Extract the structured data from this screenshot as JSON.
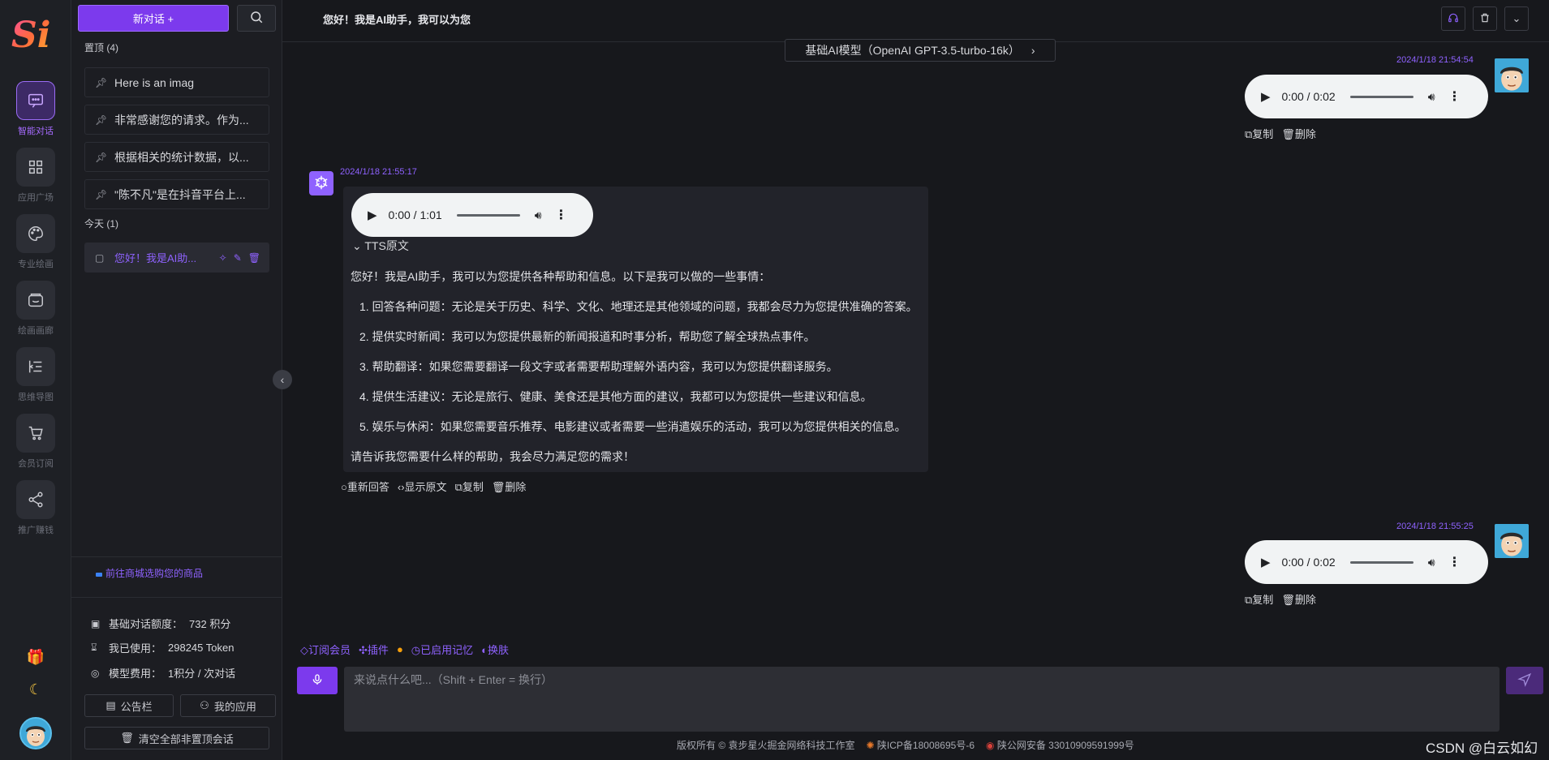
{
  "rail": {
    "logo_text": "Si",
    "items": [
      {
        "label": "智能对话",
        "icon": "chat-icon"
      },
      {
        "label": "应用广场",
        "icon": "grid-icon"
      },
      {
        "label": "专业绘画",
        "icon": "palette-icon"
      },
      {
        "label": "绘画画廊",
        "icon": "gallery-icon"
      },
      {
        "label": "思维导图",
        "icon": "mindmap-icon"
      },
      {
        "label": "会员订阅",
        "icon": "cart-icon"
      },
      {
        "label": "推广赚钱",
        "icon": "share-icon"
      }
    ]
  },
  "sidebar": {
    "new_chat_label": "新对话 +",
    "pinned_title": "置顶  (4)",
    "pinned": [
      "Here is an imag",
      "非常感谢您的请求。作为...",
      "根据相关的统计数据，以...",
      "\"陈不凡\"是在抖音平台上..."
    ],
    "today_title": "今天  (1)",
    "today": [
      "您好！我是AI助..."
    ],
    "shop_link": "前往商城选购您的商品",
    "stats": [
      {
        "label": "基础对话额度：",
        "value": "732 积分"
      },
      {
        "label": "我已使用：",
        "value": "298245 Token"
      },
      {
        "label": "模型费用：",
        "value": "1积分 / 次对话"
      }
    ],
    "notice_label": "公告栏",
    "my_apps_label": "我的应用",
    "clear_label": "清空全部非置顶会话"
  },
  "topbar": {
    "title": "您好！我是AI助手，我可以为您"
  },
  "model_tag": "基础AI模型（OpenAI GPT-3.5-turbo-16k）",
  "messages": {
    "user1": {
      "time": "2024/1/18 21:54:54",
      "audio": "0:00 / 0:02"
    },
    "ai": {
      "time": "2024/1/18 21:55:17",
      "audio": "0:00 / 1:01",
      "tts_label": "TTS原文",
      "intro": "您好！我是AI助手，我可以为您提供各种帮助和信息。以下是我可以做的一些事情：",
      "list": [
        "回答各种问题：无论是关于历史、科学、文化、地理还是其他领域的问题，我都会尽力为您提供准确的答案。",
        "提供实时新闻：我可以为您提供最新的新闻报道和时事分析，帮助您了解全球热点事件。",
        "帮助翻译：如果您需要翻译一段文字或者需要帮助理解外语内容，我可以为您提供翻译服务。",
        "提供生活建议：无论是旅行、健康、美食还是其他方面的建议，我都可以为您提供一些建议和信息。",
        "娱乐与休闲：如果您需要音乐推荐、电影建议或者需要一些消遣娱乐的活动，我可以为您提供相关的信息。"
      ],
      "outro": "请告诉我您需要什么样的帮助，我会尽力满足您的需求！",
      "regen_label": "重新回答",
      "show_raw_label": "显示原文",
      "copy_label": "复制",
      "delete_label": "删除"
    },
    "user2": {
      "time": "2024/1/18 21:55:25",
      "audio": "0:00 / 0:02"
    },
    "copy_label": "复制",
    "delete_label": "删除"
  },
  "tools": {
    "subscribe": "订阅会员",
    "plugin": "插件",
    "memory": "已启用记忆",
    "theme": "换肤"
  },
  "input": {
    "placeholder": "来说点什么吧...（Shift + Enter = 换行）"
  },
  "footer": {
    "copyright": "版权所有 © 袁步星火掘金网络科技工作室",
    "icp": "陕ICP备18008695号-6",
    "police": "陕公网安备 33010909591999号"
  },
  "watermark": "CSDN @白云如幻",
  "colors": {
    "accent": "#7c3aed",
    "accent_text": "#8f62ff",
    "background": "#17181c"
  }
}
